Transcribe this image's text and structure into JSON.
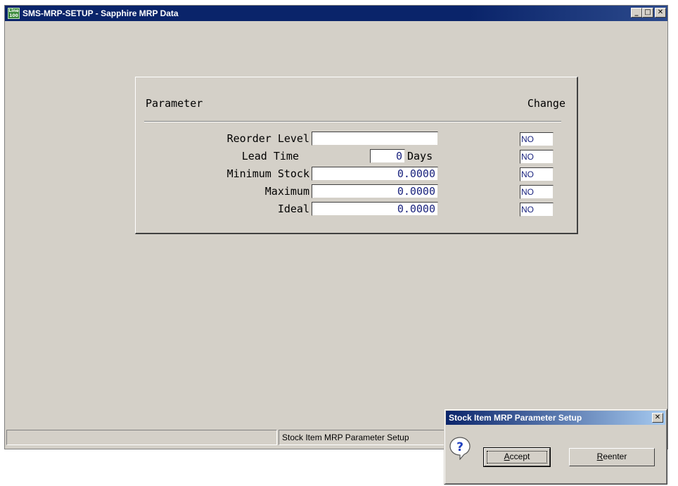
{
  "window": {
    "icon_text": [
      "Line",
      "100"
    ],
    "title": "SMS-MRP-SETUP - Sapphire MRP Data",
    "buttons": [
      "minimize-icon",
      "maximize-icon",
      "close-icon"
    ]
  },
  "panel": {
    "header_parameter": "Parameter",
    "header_change": "Change",
    "rows": [
      {
        "label": "Reorder Level",
        "value": "",
        "change": "NO"
      },
      {
        "label": "Lead Time",
        "value": "0",
        "unit": "Days",
        "change": "NO"
      },
      {
        "label": "Minimum Stock",
        "value": "0.0000",
        "change": "NO"
      },
      {
        "label": "Maximum",
        "value": "0.0000",
        "change": "NO"
      },
      {
        "label": "Ideal",
        "value": "0.0000",
        "change": "NO"
      }
    ]
  },
  "status_bar": {
    "cells": [
      "",
      "Stock Item MRP Parameter Setup"
    ]
  },
  "dialog": {
    "title": "Stock Item MRP Parameter Setup",
    "icon": "question-icon",
    "accept_label": "Accept",
    "reenter_label": "Reenter"
  },
  "colors": {
    "titlebar": "#0a246a",
    "face": "#d4d0c8",
    "field_text": "#1a237e"
  }
}
